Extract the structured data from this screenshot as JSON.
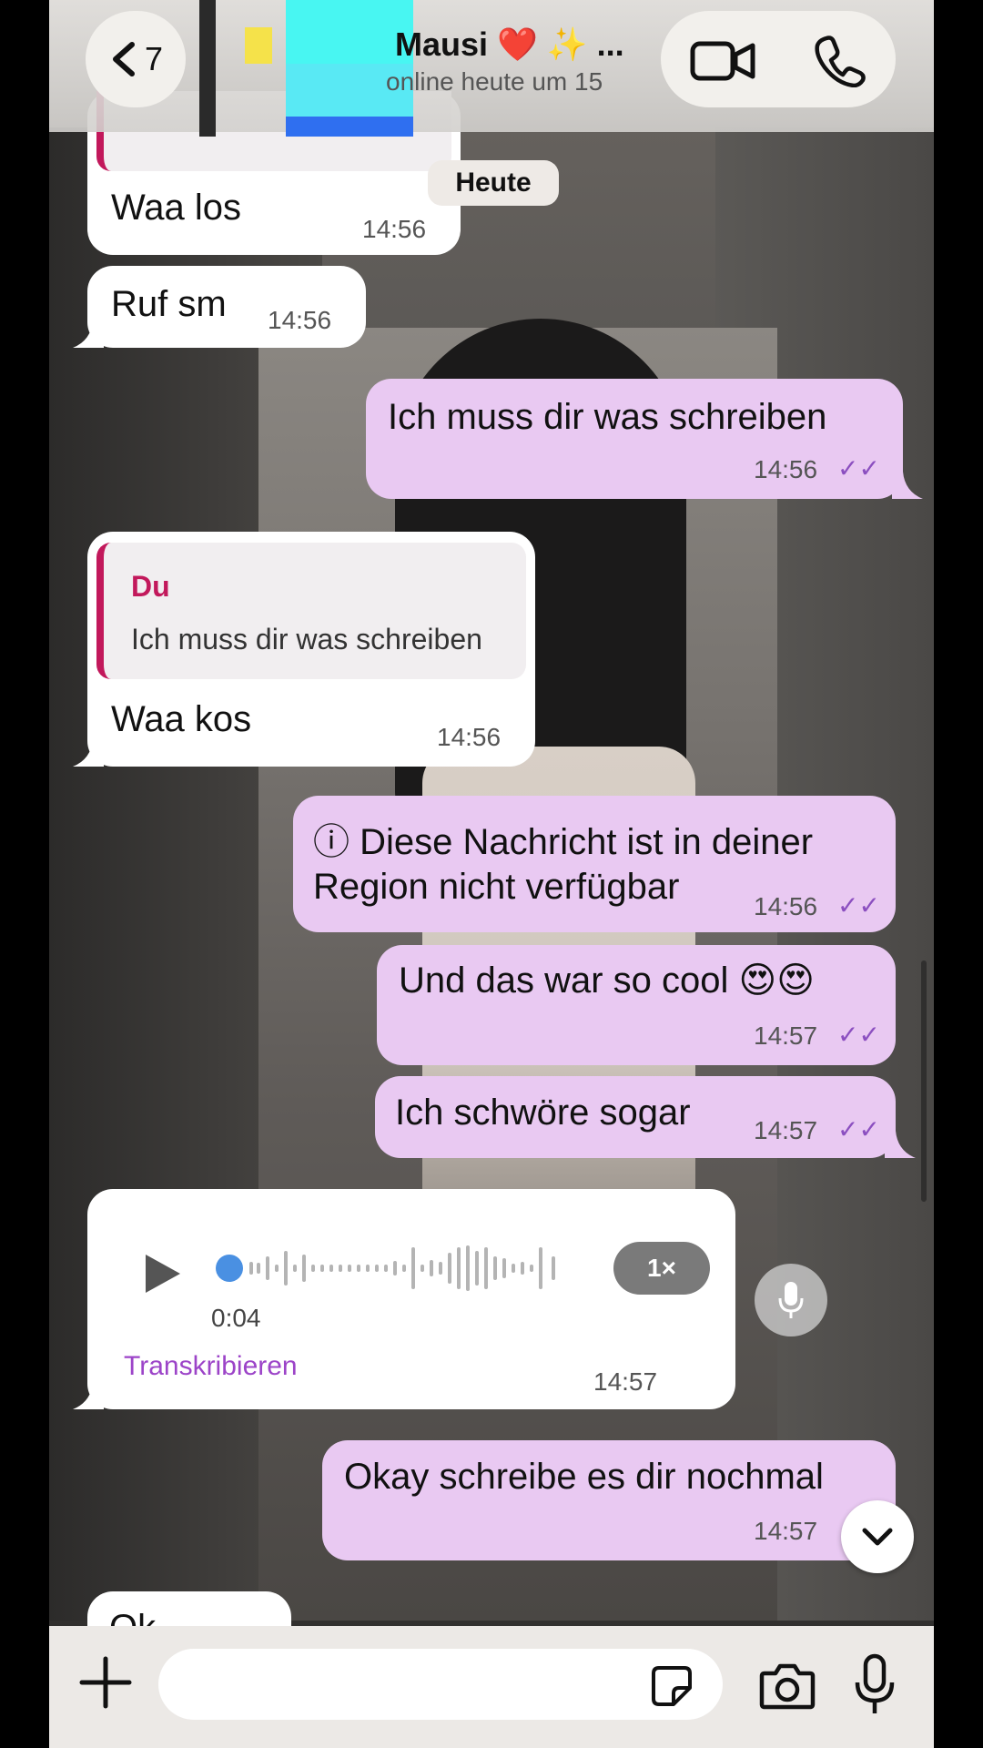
{
  "header": {
    "back_count": "7",
    "contact_name": "Mausi ❤️ ✨ ...",
    "contact_status": "online heute um 15"
  },
  "day_chip": "Heute",
  "messages": [
    {
      "dir": "in",
      "text": "Waa los",
      "time": "14:56"
    },
    {
      "dir": "in",
      "text": "Ruf sm",
      "time": "14:56"
    },
    {
      "dir": "out",
      "text": "Ich muss dir was schreiben",
      "time": "14:56",
      "ticks": "✓✓"
    },
    {
      "dir": "in",
      "quote_author": "Du",
      "quote_text": "Ich muss dir was schreiben",
      "text": "Waa kos",
      "time": "14:56"
    },
    {
      "dir": "out",
      "text_line1": "ⓘ Diese Nachricht ist in deiner",
      "text_line2": "Region nicht verfügbar",
      "time": "14:56",
      "ticks": "✓✓"
    },
    {
      "dir": "out",
      "text": "Und das war so cool 😍😍",
      "time": "14:57",
      "ticks": "✓✓"
    },
    {
      "dir": "out",
      "text": "Ich schwöre sogar",
      "time": "14:57",
      "ticks": "✓✓"
    },
    {
      "dir": "in",
      "type": "voice",
      "duration": "0:04",
      "speed": "1×",
      "transcribe": "Transkribieren",
      "time": "14:57"
    },
    {
      "dir": "out",
      "text": "Okay schreibe es dir nochmal",
      "time": "14:57"
    },
    {
      "dir": "in",
      "text": "Ok"
    }
  ],
  "composer": {
    "placeholder": ""
  },
  "icons": {
    "back": "chevron-left-icon",
    "video": "video-camera-icon",
    "call": "phone-icon",
    "plus": "plus-icon",
    "sticker": "sticker-icon",
    "camera": "camera-icon",
    "mic": "microphone-icon"
  },
  "colors": {
    "outgoing_bubble": "#e9c9f2",
    "incoming_bubble": "#ffffff",
    "quote_accent": "#c2185b",
    "ticks": "#8b4fc0",
    "transcribe_link": "#9c44c8"
  }
}
